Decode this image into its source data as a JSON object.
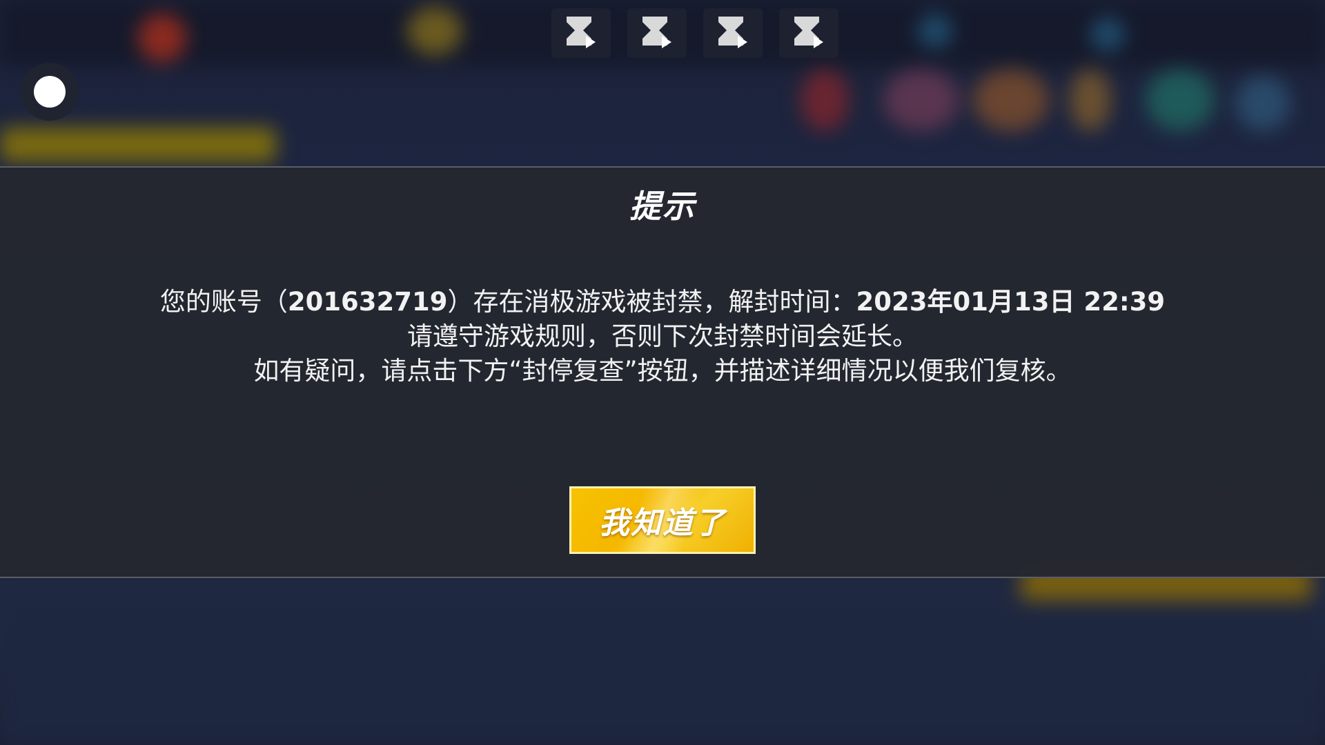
{
  "dialog": {
    "title": "提示",
    "message_line1_prefix": "您的账号（",
    "account_id": "201632719",
    "message_line1_middle": "）存在消极游戏被封禁，解封时间：",
    "unban_time": "2023年01月13日 22:39",
    "message_line2": "请遵守游戏规则，否则下次封禁时间会延长。",
    "message_line3": "如有疑问，请点击下方“封停复查”按钮，并描述详细情况以便我们复核。",
    "confirm_label": "我知道了"
  },
  "top_icons": [
    "hourglass-play-icon",
    "hourglass-play-icon",
    "hourglass-play-icon",
    "hourglass-play-icon"
  ],
  "colors": {
    "dialog_bg": "#24272f",
    "button_yellow": "#f5b700",
    "text": "#f2f2f2"
  }
}
